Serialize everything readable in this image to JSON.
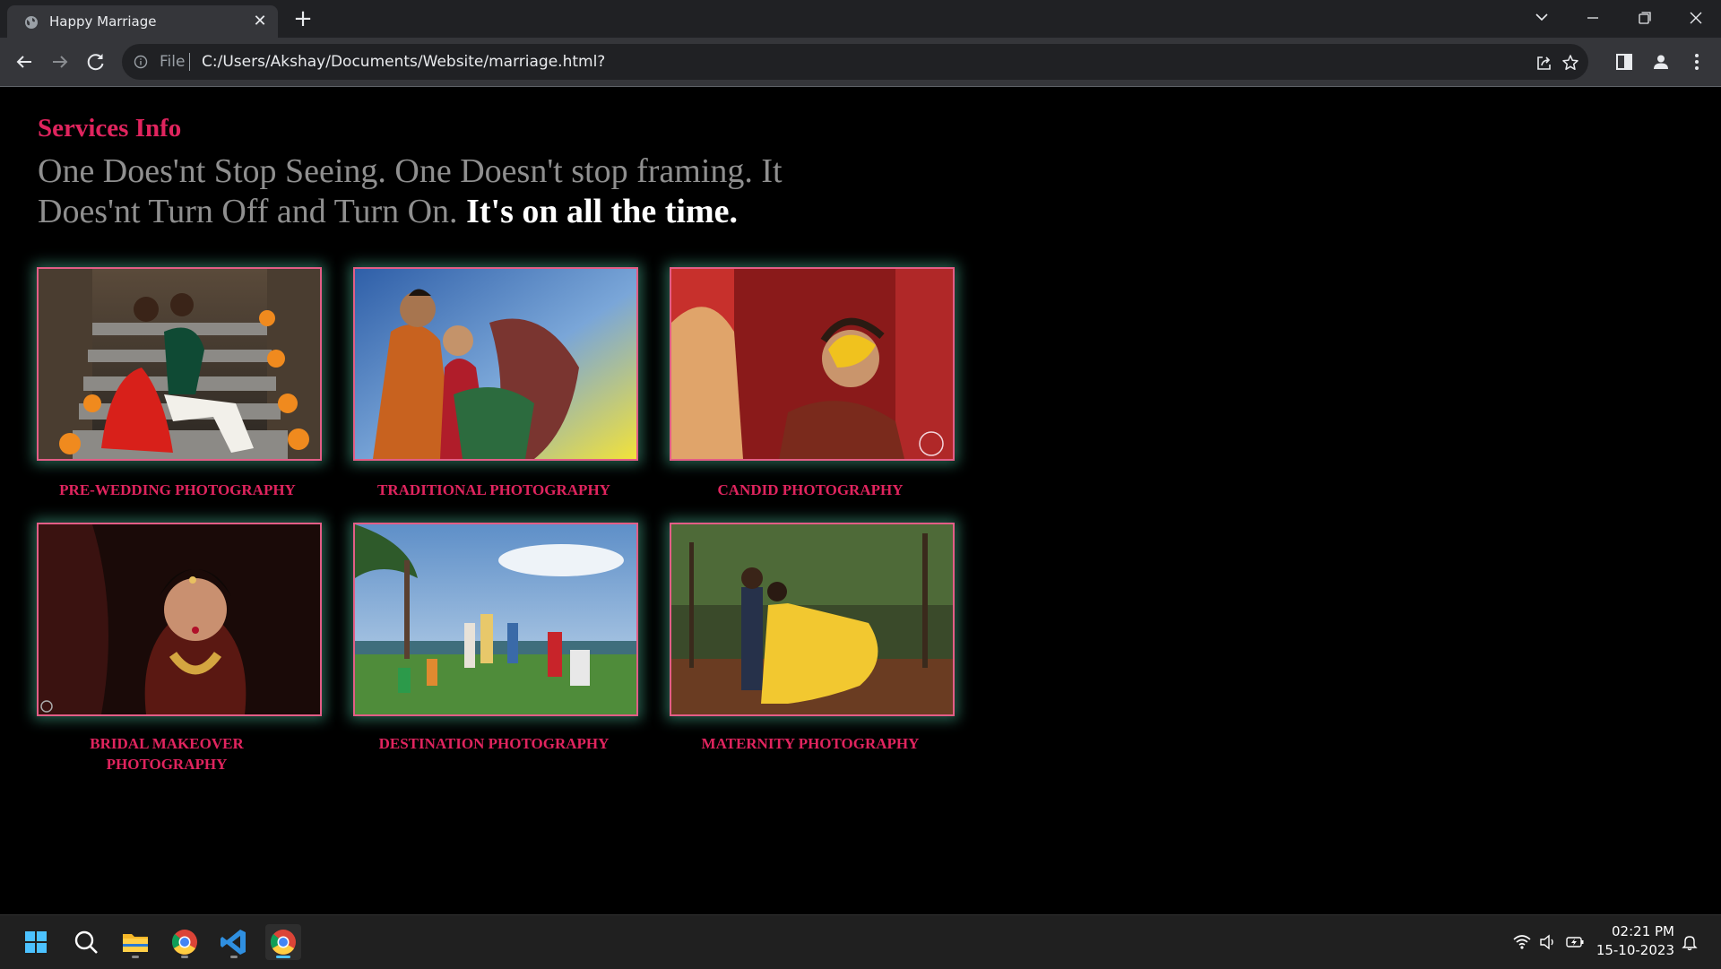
{
  "browser": {
    "tab_title": "Happy Marriage",
    "tab_close": "✕",
    "new_tab": "+",
    "scheme": "File",
    "url": "C:/Users/Akshay/Documents/Website/marriage.html?"
  },
  "page": {
    "heading": "Services Info",
    "tagline_gray": "One Does'nt Stop Seeing. One Doesn't stop framing. It Does'nt Turn Off and Turn On.",
    "tagline_bold": "It's on all the time.",
    "services": [
      {
        "caption": "PRE-WEDDING PHOTOGRAPHY"
      },
      {
        "caption": "TRADITIONAL PHOTOGRAPHY"
      },
      {
        "caption": "CANDID PHOTOGRAPHY"
      },
      {
        "caption": "BRIDAL MAKEOVER PHOTOGRAPHY"
      },
      {
        "caption": "DESTINATION PHOTOGRAPHY"
      },
      {
        "caption": "MATERNITY PHOTOGRAPHY"
      }
    ]
  },
  "taskbar": {
    "time": "02:21 PM",
    "date": "15-10-2023",
    "apps": [
      "start-icon",
      "search-icon",
      "file-explorer-icon",
      "chrome-icon",
      "vscode-icon",
      "chrome-active-icon"
    ]
  },
  "colors": {
    "accent": "#e0245e",
    "card_border": "#e35d86",
    "card_glow": "#46aa8c",
    "background": "#000000"
  }
}
